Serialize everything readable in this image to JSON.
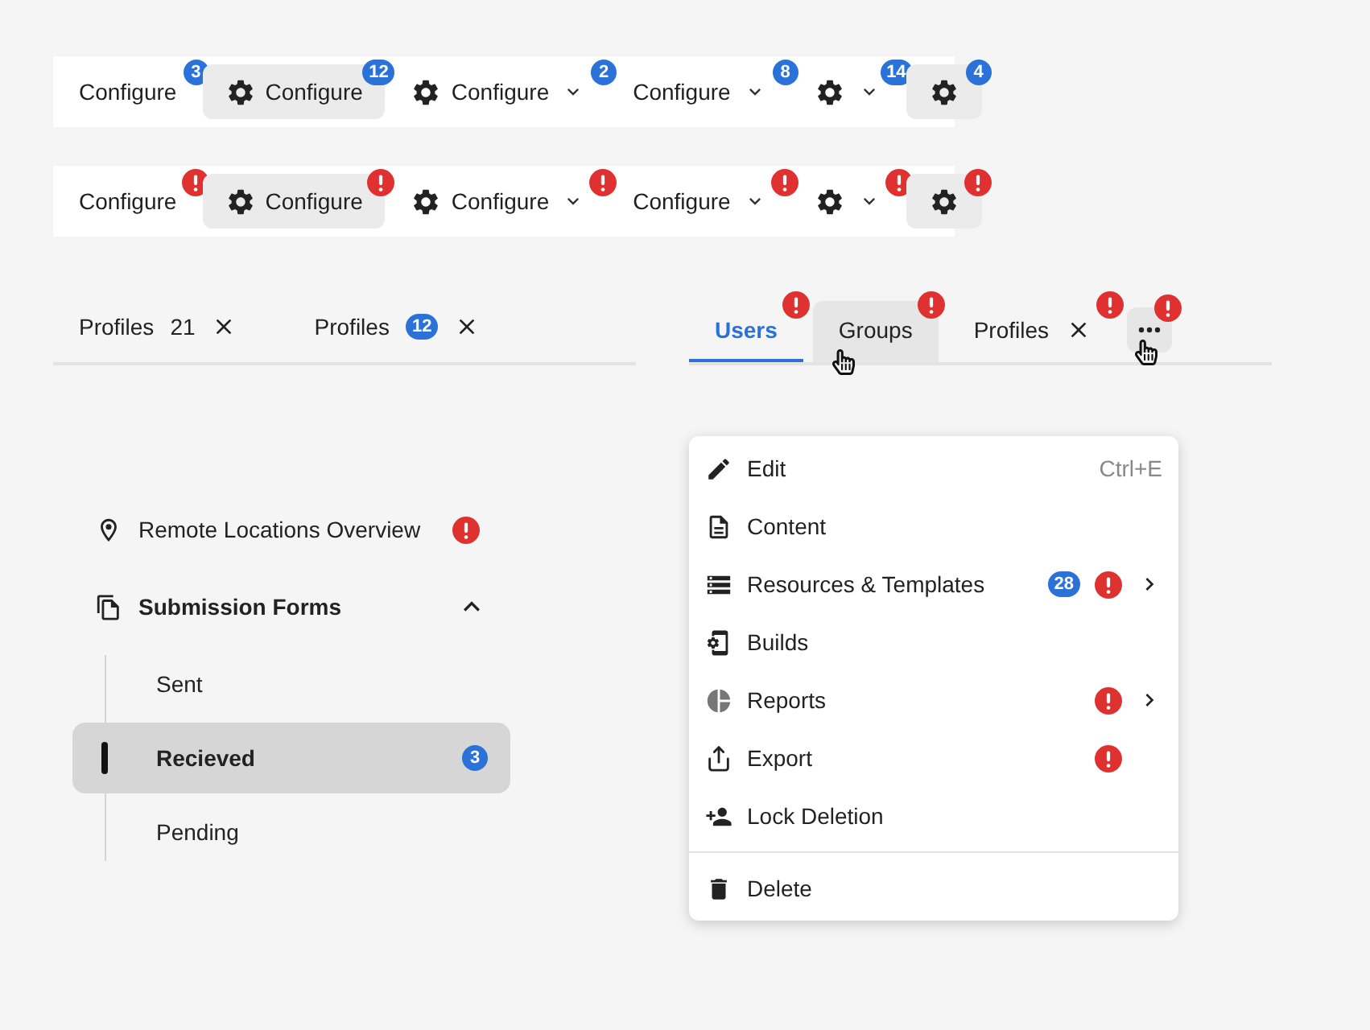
{
  "toolbars": [
    {
      "buttons": [
        {
          "kind": "text",
          "label": "Configure",
          "hovered": false,
          "badge": {
            "kind": "count",
            "text": "3"
          }
        },
        {
          "kind": "icon-text",
          "label": "Configure",
          "hovered": true,
          "badge": {
            "kind": "count",
            "text": "12"
          }
        },
        {
          "kind": "icon-text-caret",
          "label": "Configure",
          "hovered": false,
          "badge": {
            "kind": "count",
            "text": "2"
          }
        },
        {
          "kind": "text-caret",
          "label": "Configure",
          "hovered": false,
          "badge": {
            "kind": "count",
            "text": "8"
          }
        },
        {
          "kind": "icon-caret",
          "hovered": false,
          "badge": {
            "kind": "count",
            "text": "14"
          }
        },
        {
          "kind": "icon",
          "hovered": true,
          "badge": {
            "kind": "count",
            "text": "4"
          }
        }
      ]
    },
    {
      "buttons": [
        {
          "kind": "text",
          "label": "Configure",
          "hovered": false,
          "badge": {
            "kind": "alert"
          }
        },
        {
          "kind": "icon-text",
          "label": "Configure",
          "hovered": true,
          "badge": {
            "kind": "alert"
          }
        },
        {
          "kind": "icon-text-caret",
          "label": "Configure",
          "hovered": false,
          "badge": {
            "kind": "alert"
          }
        },
        {
          "kind": "text-caret",
          "label": "Configure",
          "hovered": false,
          "badge": {
            "kind": "alert"
          }
        },
        {
          "kind": "icon-caret",
          "hovered": false,
          "badge": {
            "kind": "alert"
          }
        },
        {
          "kind": "icon",
          "hovered": true,
          "badge": {
            "kind": "alert"
          }
        }
      ]
    }
  ],
  "profile_tabs": [
    {
      "label": "Profiles",
      "selected": false,
      "badge": {
        "kind": "plain",
        "text": "21"
      },
      "closable": true
    },
    {
      "label": "Profiles",
      "selected": false,
      "badge": {
        "kind": "count",
        "text": "12"
      },
      "closable": true
    }
  ],
  "user_tabs": [
    {
      "kind": "tab",
      "label": "Users",
      "selected": true,
      "hovered": false,
      "badge": {
        "kind": "alert"
      }
    },
    {
      "kind": "tab",
      "label": "Groups",
      "selected": false,
      "hovered": true,
      "badge": {
        "kind": "alert"
      }
    },
    {
      "kind": "tab",
      "label": "Profiles",
      "selected": false,
      "hovered": false,
      "closable": true,
      "badge": {
        "kind": "alert"
      }
    },
    {
      "kind": "more",
      "hovered": true,
      "badge": {
        "kind": "alert"
      }
    }
  ],
  "sidebar": {
    "items": [
      {
        "label": "Remote Locations Overview",
        "badge": {
          "kind": "alert"
        }
      },
      {
        "label": "Submission Forms",
        "expanded": true,
        "children": [
          {
            "label": "Sent",
            "selected": false
          },
          {
            "label": "Recieved",
            "selected": true,
            "badge": {
              "kind": "count",
              "text": "3"
            }
          },
          {
            "label": "Pending",
            "selected": false
          }
        ]
      }
    ]
  },
  "menu": {
    "groups": [
      [
        {
          "label": "Edit",
          "shortcut": "Ctrl+E"
        },
        {
          "label": "Content"
        },
        {
          "label": "Resources & Templates",
          "badge": {
            "kind": "count",
            "text": "28"
          },
          "alert": true,
          "submenu": true
        },
        {
          "label": "Builds"
        },
        {
          "label": "Reports",
          "alert": true,
          "submenu": true
        },
        {
          "label": "Export",
          "alert": true
        },
        {
          "label": "Lock Deletion"
        }
      ],
      [
        {
          "label": "Delete"
        }
      ]
    ]
  }
}
